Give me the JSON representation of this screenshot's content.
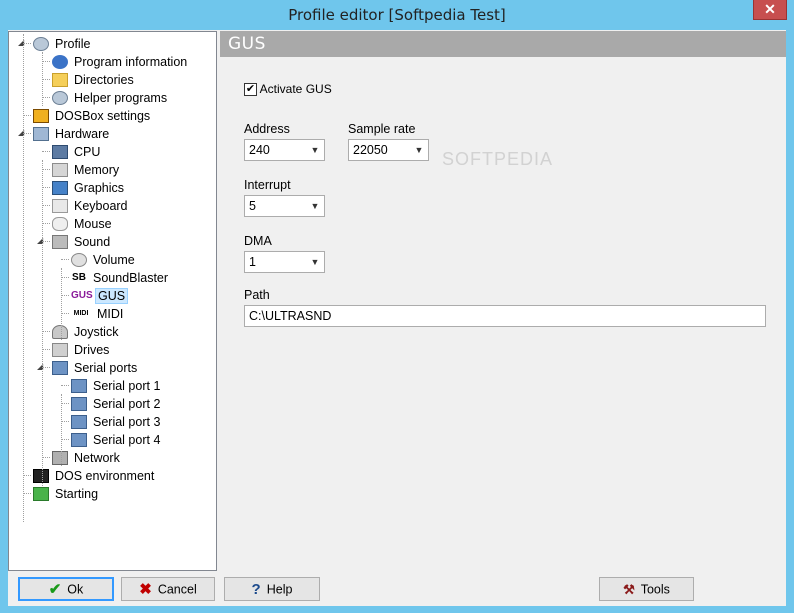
{
  "window": {
    "title": "Profile editor [Softpedia Test]",
    "close_label": "✕"
  },
  "tree": [
    {
      "label": "Profile",
      "icon": "gears-icon"
    },
    {
      "label": "Program information",
      "icon": "info-icon"
    },
    {
      "label": "Directories",
      "icon": "folder-icon"
    },
    {
      "label": "Helper programs",
      "icon": "gears-icon"
    },
    {
      "label": "DOSBox settings",
      "icon": "dosbox-icon"
    },
    {
      "label": "Hardware",
      "icon": "hardware-icon"
    },
    {
      "label": "CPU",
      "icon": "computer-icon"
    },
    {
      "label": "Memory",
      "icon": "memory-icon"
    },
    {
      "label": "Graphics",
      "icon": "monitor-icon"
    },
    {
      "label": "Keyboard",
      "icon": "keyboard-icon"
    },
    {
      "label": "Mouse",
      "icon": "mouse-icon"
    },
    {
      "label": "Sound",
      "icon": "speaker-icon"
    },
    {
      "label": "Volume",
      "icon": "volume-icon"
    },
    {
      "label": "SoundBlaster",
      "icon": "soundblaster-icon",
      "badge": "SB"
    },
    {
      "label": "GUS",
      "icon": "gus-icon",
      "badge": "GUS"
    },
    {
      "label": "MIDI",
      "icon": "midi-icon",
      "badge": "MIDI"
    },
    {
      "label": "Joystick",
      "icon": "joystick-icon"
    },
    {
      "label": "Drives",
      "icon": "drive-icon"
    },
    {
      "label": "Serial ports",
      "icon": "serial-icon"
    },
    {
      "label": "Serial port 1",
      "icon": "serial-icon"
    },
    {
      "label": "Serial port 2",
      "icon": "serial-icon"
    },
    {
      "label": "Serial port 3",
      "icon": "serial-icon"
    },
    {
      "label": "Serial port 4",
      "icon": "serial-icon"
    },
    {
      "label": "Network",
      "icon": "network-icon"
    },
    {
      "label": "DOS environment",
      "icon": "terminal-icon"
    },
    {
      "label": "Starting",
      "icon": "start-icon"
    }
  ],
  "panel": {
    "header": "GUS",
    "activate_label": "Activate GUS",
    "activate_checked": "✔",
    "address_label": "Address",
    "address_value": "240",
    "sample_rate_label": "Sample rate",
    "sample_rate_value": "22050",
    "interrupt_label": "Interrupt",
    "interrupt_value": "5",
    "dma_label": "DMA",
    "dma_value": "1",
    "path_label": "Path",
    "path_value": "C:\\ULTRASND",
    "watermark": "SOFTPEDIA"
  },
  "buttons": {
    "ok": "Ok",
    "cancel": "Cancel",
    "help": "Help",
    "tools": "Tools"
  },
  "colors": {
    "accent": "#3399ff",
    "title_bg": "#6fc6ec",
    "header_bg": "#a9a9a9",
    "selection": "#cce8ff"
  }
}
